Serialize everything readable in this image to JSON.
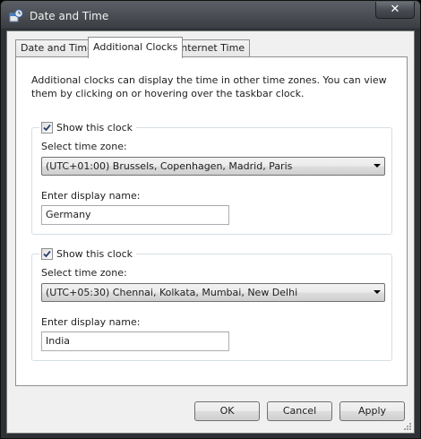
{
  "window": {
    "title": "Date and Time",
    "close_glyph": "✕"
  },
  "tabs": [
    {
      "label": "Date and Time",
      "active": false
    },
    {
      "label": "Additional Clocks",
      "active": true
    },
    {
      "label": "Internet Time",
      "active": false
    }
  ],
  "panel": {
    "intro_line1": "Additional clocks can display the time in other time zones. You can view",
    "intro_line2": "them by clicking on or hovering over the taskbar clock."
  },
  "clocks": [
    {
      "show_label": "Show this clock",
      "checked": true,
      "timezone_label": "Select time zone:",
      "timezone_value": "(UTC+01:00) Brussels, Copenhagen, Madrid, Paris",
      "name_label": "Enter display name:",
      "name_value": "Germany"
    },
    {
      "show_label": "Show this clock",
      "checked": true,
      "timezone_label": "Select time zone:",
      "timezone_value": "(UTC+05:30) Chennai, Kolkata, Mumbai, New Delhi",
      "name_label": "Enter display name:",
      "name_value": "India"
    }
  ],
  "buttons": {
    "ok": "OK",
    "cancel": "Cancel",
    "apply": "Apply"
  },
  "icons": {
    "title": "date-time-icon",
    "close": "close-icon",
    "check": "checkmark-icon",
    "dropdown": "chevron-down-icon"
  }
}
